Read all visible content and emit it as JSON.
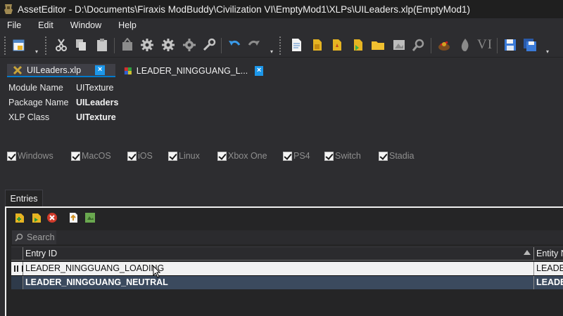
{
  "window": {
    "title": "AssetEditor - D:\\Documents\\Firaxis ModBuddy\\Civilization VI\\EmptyMod1\\XLPs\\UILeaders.xlp(EmptyMod1)"
  },
  "menu": [
    "File",
    "Edit",
    "Window",
    "Help"
  ],
  "toolbar": {
    "vi_label": "VI"
  },
  "tabs": [
    {
      "label": "UILeaders.xlp",
      "close": "×",
      "active": true
    },
    {
      "label": "LEADER_NINGGUANG_L...",
      "close": "×",
      "active": false
    }
  ],
  "properties": [
    {
      "label": "Module Name",
      "value": "UITexture",
      "bold": false
    },
    {
      "label": "Package Name",
      "value": "UILeaders",
      "bold": true
    },
    {
      "label": "XLP Class",
      "value": "UITexture",
      "bold": true
    }
  ],
  "platforms": [
    {
      "label": "Windows",
      "checked": true
    },
    {
      "label": "MacOS",
      "checked": true
    },
    {
      "label": "iOS",
      "checked": true
    },
    {
      "label": "Linux",
      "checked": true
    },
    {
      "label": "Xbox One",
      "checked": true
    },
    {
      "label": "PS4",
      "checked": true
    },
    {
      "label": "Switch",
      "checked": true
    },
    {
      "label": "Stadia",
      "checked": true
    }
  ],
  "entries": {
    "tab_label": "Entries",
    "search_placeholder": "Search",
    "columns": [
      "Entry ID",
      "Entity N"
    ],
    "rows": [
      {
        "entry_id": "LEADER_NINGGUANG_LOADING",
        "entity": "LEADE"
      },
      {
        "entry_id": "LEADER_NINGGUANG_NEUTRAL",
        "entity": "LEADE"
      }
    ]
  },
  "colors": {
    "accent": "#007acc",
    "tab_close": "#1c97ea",
    "selected_row": "#3b4a5e",
    "background": "#2d2d30"
  }
}
